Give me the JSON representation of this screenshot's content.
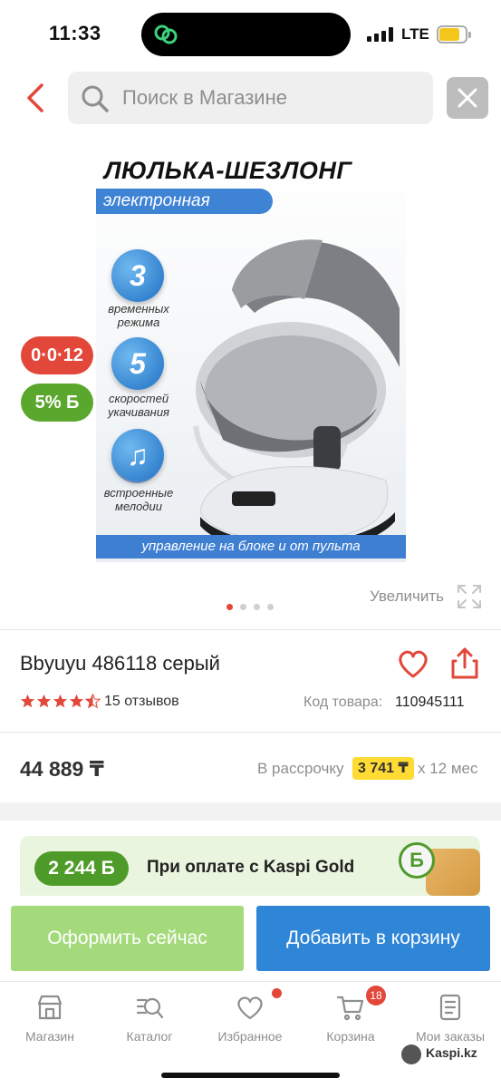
{
  "status_bar": {
    "time": "11:33",
    "network": "LTE"
  },
  "search": {
    "placeholder": "Поиск в Магазине"
  },
  "product_image": {
    "title": "ЛЮЛЬКА-ШЕЗЛОНГ",
    "subtitle": "электронная",
    "features": [
      {
        "number": "3",
        "text": "временных режима"
      },
      {
        "number": "5",
        "text": "скоростей укачивания"
      },
      {
        "number": "",
        "text": "встроенные мелодии"
      }
    ],
    "bottom_banner": "управление на блоке и от пульта"
  },
  "badges": {
    "credit": "0·0·12",
    "bonus": "5% Б"
  },
  "gallery": {
    "zoom_label": "Увеличить",
    "slides": 4,
    "active_slide": 1
  },
  "product": {
    "name": "Bbyuyu 486118 серый",
    "rating": 4.5,
    "reviews": "15 отзывов",
    "code_label": "Код товара:",
    "code": "110945111",
    "price": "44 889 ₸",
    "installment_label": "В рассрочку",
    "installment_value": "3 741 ₸",
    "installment_term": "х 12 мес"
  },
  "kaspi_gold": {
    "bonus": "2 244 Б",
    "text": "При оплате с Kaspi Gold"
  },
  "actions": {
    "order": "Оформить сейчас",
    "add_to_cart": "Добавить в корзину"
  },
  "tabbar": {
    "items": [
      {
        "label": "Магазин",
        "icon": "shop-icon"
      },
      {
        "label": "Каталог",
        "icon": "catalog-icon"
      },
      {
        "label": "Избранное",
        "icon": "heart-icon"
      },
      {
        "label": "Корзина",
        "icon": "cart-icon"
      },
      {
        "label": "Мои заказы",
        "icon": "orders-icon"
      }
    ],
    "cart_count": "18"
  },
  "watermark": "Kaspi.kz",
  "colors": {
    "accent_red": "#e2473a",
    "green": "#5aa72d",
    "blue": "#2f86d7",
    "light_green": "#a4da7b",
    "yellow": "#ffdb33"
  }
}
